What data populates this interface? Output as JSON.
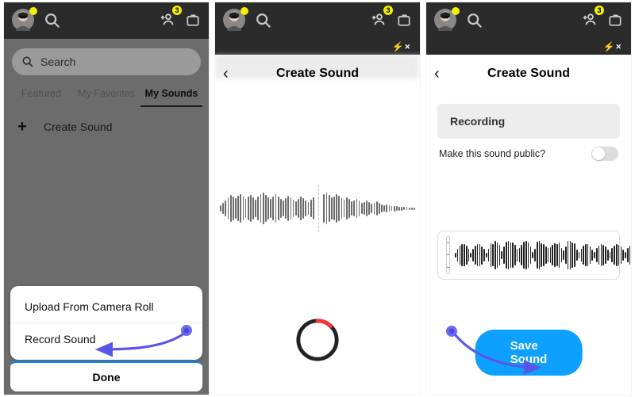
{
  "topbar": {
    "badge": "3",
    "flash": "✦"
  },
  "panel1": {
    "search_placeholder": "Search",
    "tabs": {
      "featured": "Featured",
      "favorites": "My Favorites",
      "mysounds": "My Sounds"
    },
    "create_label": "Create Sound",
    "sheet": {
      "upload": "Upload From Camera Roll",
      "record": "Record Sound"
    },
    "done": "Done"
  },
  "panel2": {
    "title": "Create Sound"
  },
  "panel3": {
    "title": "Create Sound",
    "recording_label": "Recording",
    "public_label": "Make this sound public?",
    "save_label": "Save Sound"
  }
}
